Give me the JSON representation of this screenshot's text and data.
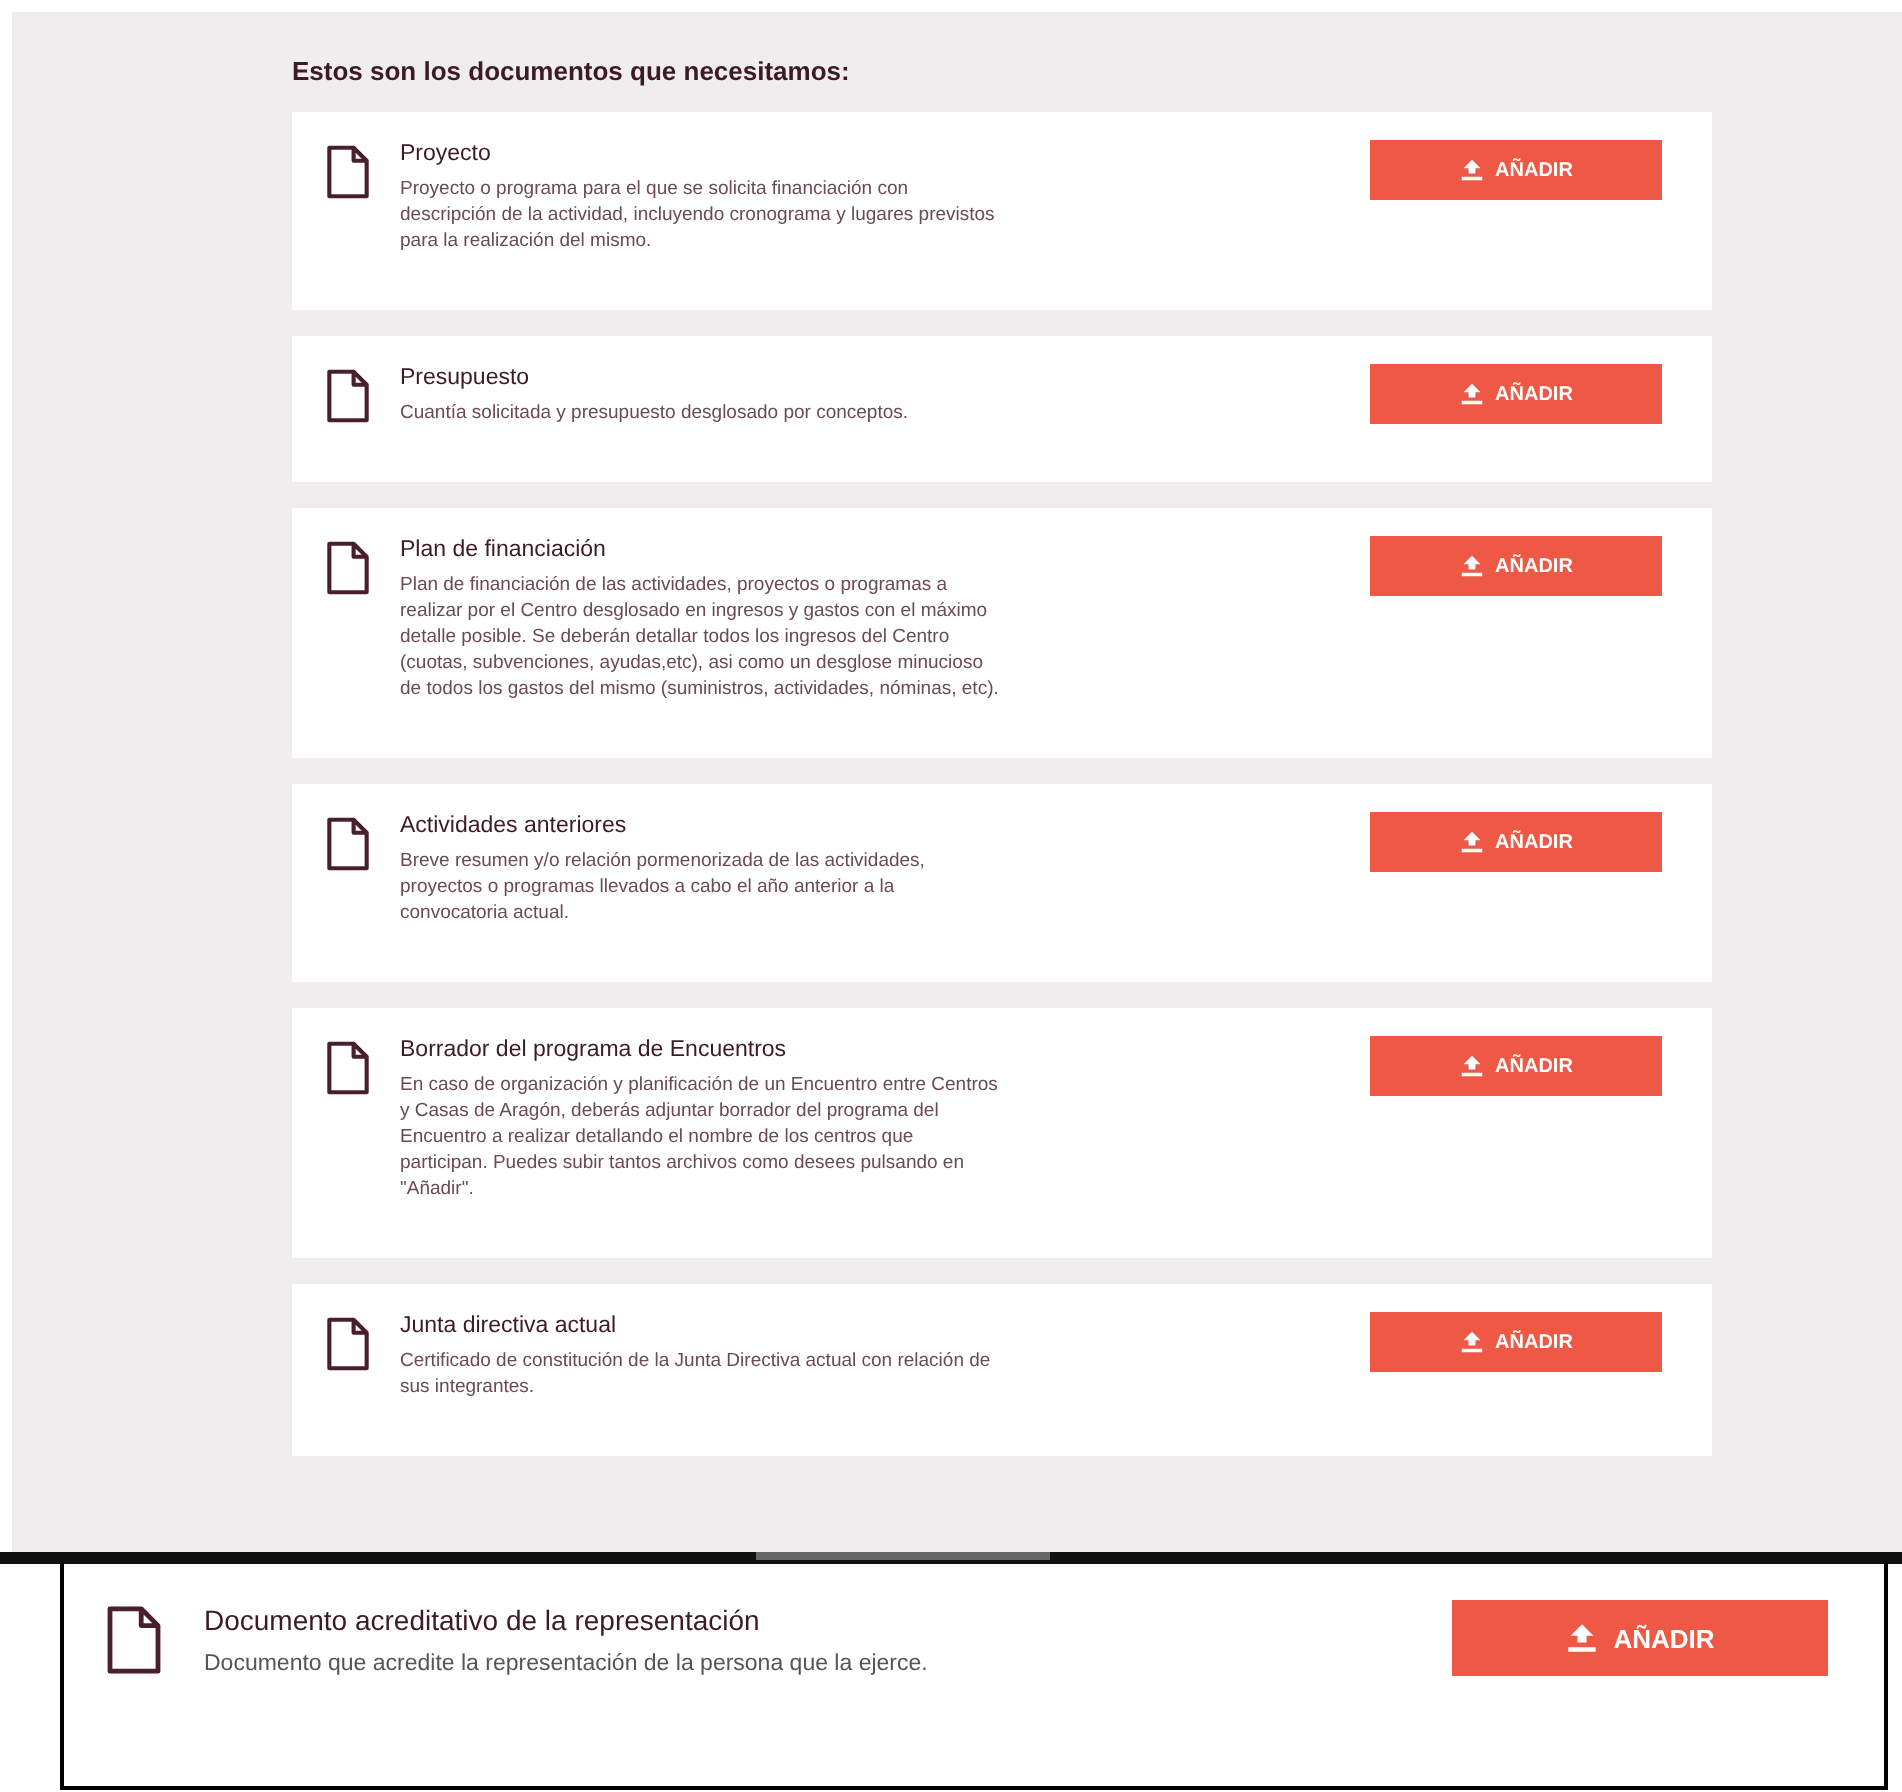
{
  "heading": "Estos son los documentos que necesitamos:",
  "documents": [
    {
      "title": "Proyecto",
      "description": "Proyecto o programa para el que se solicita financiación con descripción de la actividad, incluyendo cronograma y lugares previstos para la realización del mismo.",
      "button": "AÑADIR"
    },
    {
      "title": "Presupuesto",
      "description": "Cuantía solicitada y presupuesto desglosado por conceptos.",
      "button": "AÑADIR"
    },
    {
      "title": "Plan de financiación",
      "description": "Plan de financiación de las actividades, proyectos o programas a realizar por el Centro desglosado en ingresos y gastos con el máximo detalle posible. Se deberán detallar todos los ingresos del Centro (cuotas, subvenciones, ayudas,etc), asi como un desglose minucioso de todos los gastos del mismo (suministros, actividades, nóminas, etc).",
      "button": "AÑADIR"
    },
    {
      "title": "Actividades anteriores",
      "description": "Breve resumen y/o relación pormenorizada de las actividades, proyectos o programas llevados a cabo el año anterior a la convocatoria actual.",
      "button": "AÑADIR"
    },
    {
      "title": "Borrador del programa de Encuentros",
      "description": "En caso de organización y planificación de un Encuentro entre Centros y Casas de Aragón, deberás adjuntar borrador del programa del Encuentro a realizar detallando el nombre de los centros que participan. Puedes subir tantos archivos como desees pulsando en \"Añadir\".",
      "button": "AÑADIR"
    },
    {
      "title": "Junta directiva actual",
      "description": "Certificado de constitución de la Junta Directiva actual con relación de sus integrantes.",
      "button": "AÑADIR"
    }
  ],
  "featured_document": {
    "title": "Documento acreditativo de la representación",
    "description": "Documento que acredite la representación de la persona que la ejerce.",
    "button": "AÑADIR"
  }
}
